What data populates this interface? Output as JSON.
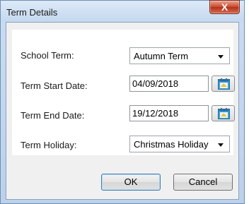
{
  "window": {
    "title": "Term Details",
    "close_label": "X"
  },
  "form": {
    "school_term": {
      "label": "School Term:",
      "value": "Autumn Term"
    },
    "term_start_date": {
      "label": "Term Start Date:",
      "value": "04/09/2018"
    },
    "term_end_date": {
      "label": "Term End Date:",
      "value": "19/12/2018"
    },
    "term_holiday": {
      "label": "Term Holiday:",
      "value": "Christmas Holiday"
    }
  },
  "buttons": {
    "ok_label": "OK",
    "cancel_label": "Cancel"
  },
  "icons": {
    "calendar": "calendar-icon",
    "dropdown": "chevron-down-icon",
    "close": "close-icon"
  },
  "colors": {
    "title_bar": "#c9dbf0",
    "close_button": "#c9462c",
    "default_button_border": "#3c7fb1"
  }
}
